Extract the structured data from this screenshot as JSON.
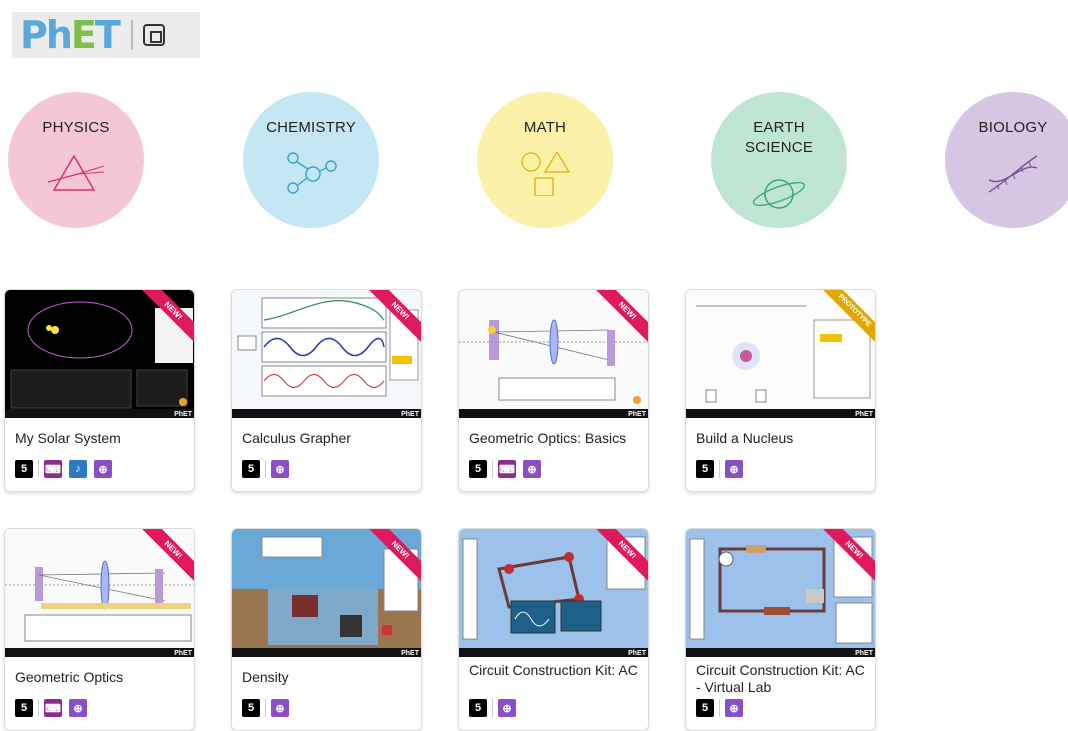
{
  "logo": {
    "letters": [
      "P",
      "h",
      "E",
      "T"
    ]
  },
  "categories": [
    {
      "label_line1": "PHYSICS",
      "label_line2": "",
      "color": "#f5c6d6",
      "icon": "prism-icon",
      "icon_color": "#d6336c"
    },
    {
      "label_line1": "CHEMISTRY",
      "label_line2": "",
      "color": "#c5e7f3",
      "icon": "molecule-icon",
      "icon_color": "#3aa0cf"
    },
    {
      "label_line1": "MATH",
      "label_line2": "",
      "color": "#fbf1a9",
      "icon": "shapes-icon",
      "icon_color": "#e7b919"
    },
    {
      "label_line1": "EARTH",
      "label_line2": "SCIENCE",
      "color": "#bfe6d5",
      "icon": "planet-icon",
      "icon_color": "#3aa57a"
    },
    {
      "label_line1": "BIOLOGY",
      "label_line2": "",
      "color": "#d7c6e2",
      "icon": "dna-icon",
      "icon_color": "#7a4d94"
    }
  ],
  "sims": [
    {
      "title": "My Solar System",
      "ribbon": "NEW!",
      "ribbon_color": "#e0195c",
      "badges": [
        "html5",
        "keyboard",
        "sound",
        "zoom"
      ]
    },
    {
      "title": "Calculus Grapher",
      "ribbon": "NEW!",
      "ribbon_color": "#e0195c",
      "badges": [
        "html5",
        "zoom"
      ]
    },
    {
      "title": "Geometric Optics: Basics",
      "ribbon": "NEW!",
      "ribbon_color": "#e0195c",
      "badges": [
        "html5",
        "keyboard",
        "zoom"
      ]
    },
    {
      "title": "Build a Nucleus",
      "ribbon": "PROTOTYPE",
      "ribbon_color": "#e3a500",
      "badges": [
        "html5",
        "zoom"
      ]
    },
    {
      "title": "Geometric Optics",
      "ribbon": "NEW!",
      "ribbon_color": "#e0195c",
      "badges": [
        "html5",
        "keyboard",
        "zoom"
      ]
    },
    {
      "title": "Density",
      "ribbon": "NEW!",
      "ribbon_color": "#e0195c",
      "badges": [
        "html5",
        "zoom"
      ]
    },
    {
      "title": "Circuit Construction Kit: AC",
      "ribbon": "NEW!",
      "ribbon_color": "#e0195c",
      "badges": [
        "html5",
        "zoom"
      ]
    },
    {
      "title": "Circuit Construction Kit: AC - Virtual Lab",
      "ribbon": "NEW!",
      "ribbon_color": "#e0195c",
      "badges": [
        "html5",
        "zoom"
      ]
    }
  ],
  "thumb_bar_label": "PhET"
}
